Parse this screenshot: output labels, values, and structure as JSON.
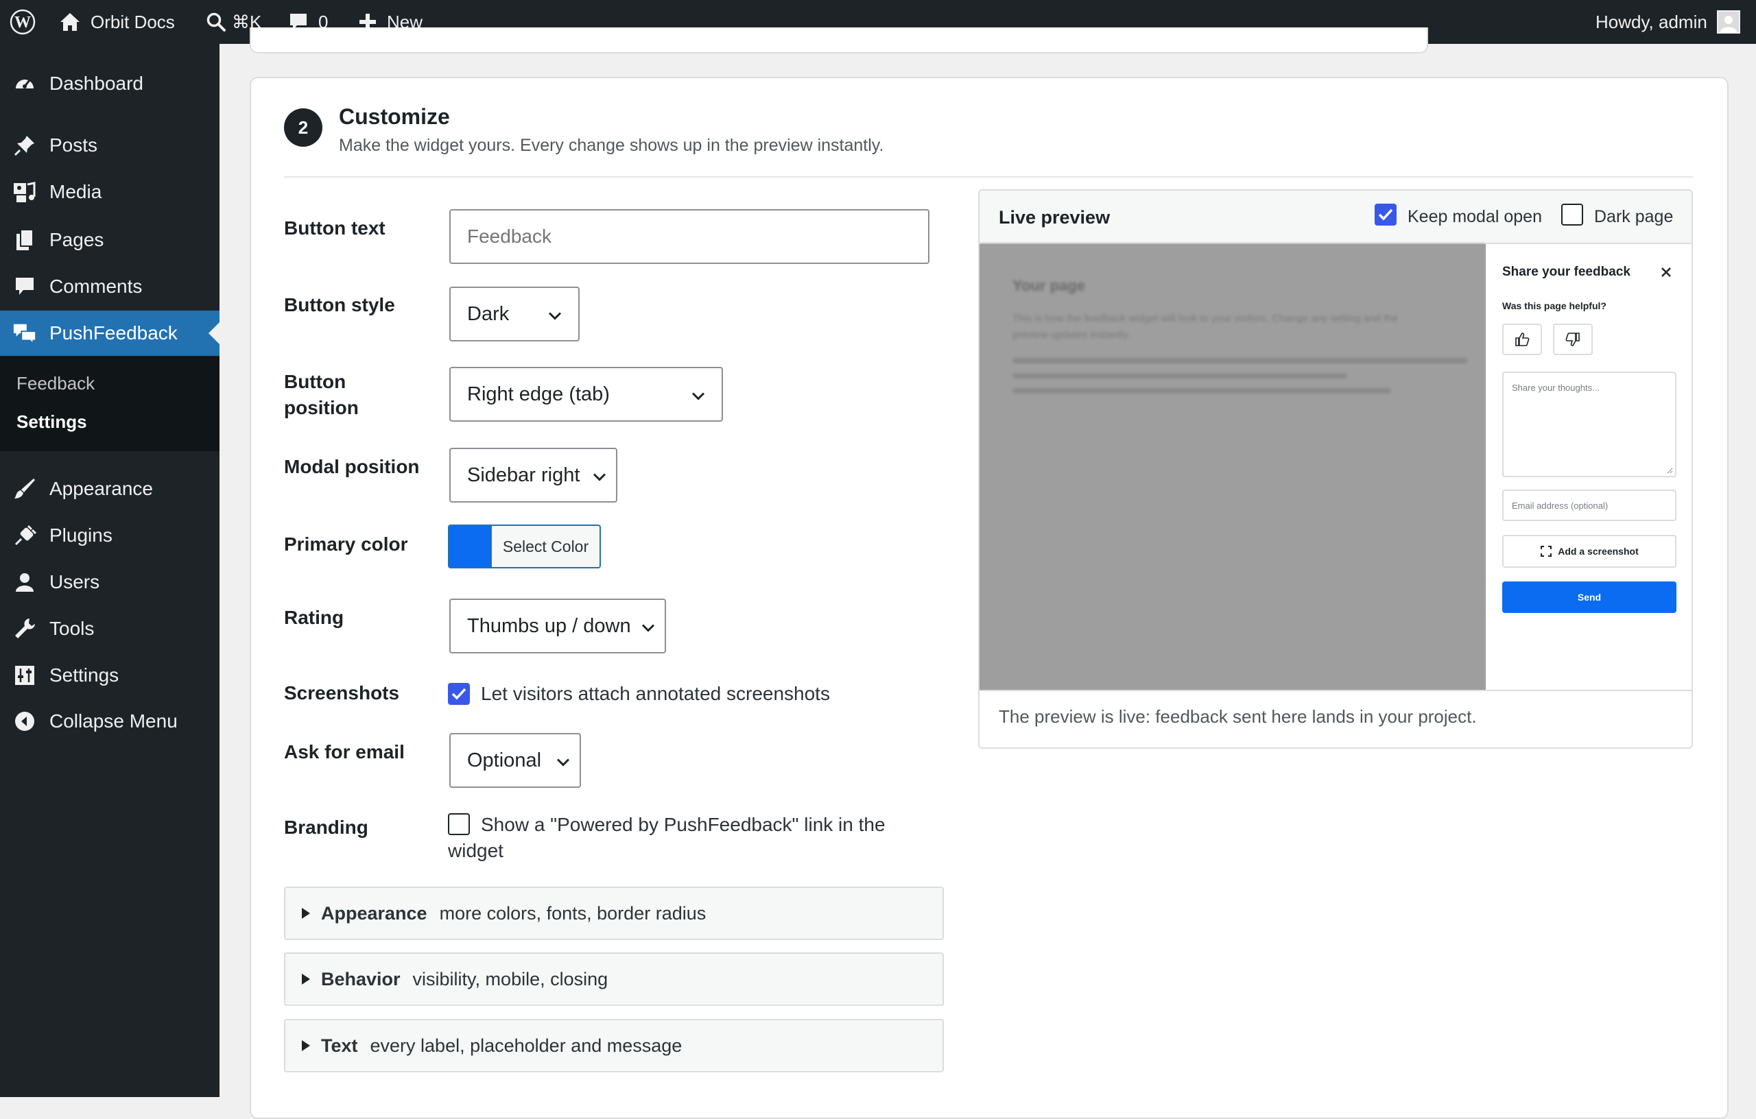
{
  "adminbar": {
    "site_name": "Orbit Docs",
    "search_shortcut": "⌘K",
    "comments_count": "0",
    "new_label": "New",
    "howdy": "Howdy, admin"
  },
  "sidebar": {
    "items": [
      {
        "label": "Dashboard",
        "icon": "dashboard-icon"
      },
      {
        "label": "Posts",
        "icon": "pin-icon"
      },
      {
        "label": "Media",
        "icon": "media-icon"
      },
      {
        "label": "Pages",
        "icon": "pages-icon"
      },
      {
        "label": "Comments",
        "icon": "comment-icon"
      },
      {
        "label": "PushFeedback",
        "icon": "feedback-icon",
        "active": true
      },
      {
        "label": "Appearance",
        "icon": "brush-icon"
      },
      {
        "label": "Plugins",
        "icon": "plug-icon"
      },
      {
        "label": "Users",
        "icon": "user-icon"
      },
      {
        "label": "Tools",
        "icon": "wrench-icon"
      },
      {
        "label": "Settings",
        "icon": "sliders-icon"
      },
      {
        "label": "Collapse Menu",
        "icon": "collapse-icon"
      }
    ],
    "submenu": [
      {
        "label": "Feedback"
      },
      {
        "label": "Settings",
        "current": true
      }
    ]
  },
  "section": {
    "step": "2",
    "title": "Customize",
    "description": "Make the widget yours. Every change shows up in the preview instantly."
  },
  "form": {
    "button_text": {
      "label": "Button text",
      "value": "",
      "placeholder": "Feedback"
    },
    "button_style": {
      "label": "Button style",
      "value": "Dark"
    },
    "button_position": {
      "label_line1": "Button",
      "label_line2": "position",
      "value": "Right edge (tab)"
    },
    "modal_position": {
      "label": "Modal position",
      "value": "Sidebar right"
    },
    "primary_color": {
      "label": "Primary color",
      "color": "#0b6cf2",
      "button_label": "Select Color"
    },
    "rating": {
      "label": "Rating",
      "value": "Thumbs up / down"
    },
    "screenshots": {
      "label": "Screenshots",
      "checked": true,
      "text": "Let visitors attach annotated screenshots"
    },
    "ask_email": {
      "label": "Ask for email",
      "value": "Optional"
    },
    "branding": {
      "label": "Branding",
      "checked": false,
      "text_line1": "Show a \"Powered by PushFeedback\" link in the",
      "text_line2": "widget"
    }
  },
  "accordions": [
    {
      "title": "Appearance",
      "subtitle": "more colors, fonts, border radius"
    },
    {
      "title": "Behavior",
      "subtitle": "visibility, mobile, closing"
    },
    {
      "title": "Text",
      "subtitle": "every label, placeholder and message"
    }
  ],
  "preview": {
    "title": "Live preview",
    "keep_modal_open": {
      "label": "Keep modal open",
      "checked": true
    },
    "dark_page": {
      "label": "Dark page",
      "checked": false
    },
    "page": {
      "heading": "Your page",
      "body_line1": "This is how the feedback widget will look to your visitors. Change any setting and the",
      "body_line2": "preview updates instantly."
    },
    "modal": {
      "title": "Share your feedback",
      "question": "Was this page helpful?",
      "textarea_placeholder": "Share your thoughts...",
      "email_placeholder": "Email address (optional)",
      "screenshot_button": "Add a screenshot",
      "send_button": "Send"
    },
    "footer": "The preview is live: feedback sent here lands in your project."
  },
  "colors": {
    "admin_bar": "#1d2327",
    "active_menu": "#2271b1",
    "checkbox": "#3858e9",
    "send_button": "#0b6cf2"
  }
}
